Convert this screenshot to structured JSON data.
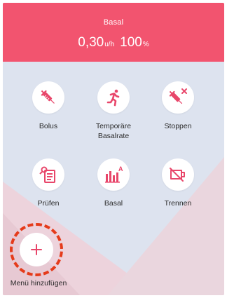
{
  "header": {
    "label": "Basal",
    "rate": "0,30",
    "rate_unit": "u/h",
    "percent": "100",
    "percent_unit": "%"
  },
  "menu": {
    "bolus": "Bolus",
    "temp_basal_line1": "Temporäre",
    "temp_basal_line2": "Basalrate",
    "stop": "Stoppen",
    "check": "Prüfen",
    "basal": "Basal",
    "disconnect": "Trennen"
  },
  "add_menu": {
    "label": "Menü hinzufügen"
  },
  "colors": {
    "accent": "#f2546f",
    "background": "#dde3ef",
    "highlight_ring": "#e53b1b"
  },
  "icons": {
    "bolus": "syringe-icon",
    "temp_basal": "running-person-icon",
    "stop": "syringe-stop-icon",
    "check": "check-document-icon",
    "basal": "basal-chart-icon",
    "disconnect": "disconnect-icon",
    "add": "plus-icon"
  }
}
